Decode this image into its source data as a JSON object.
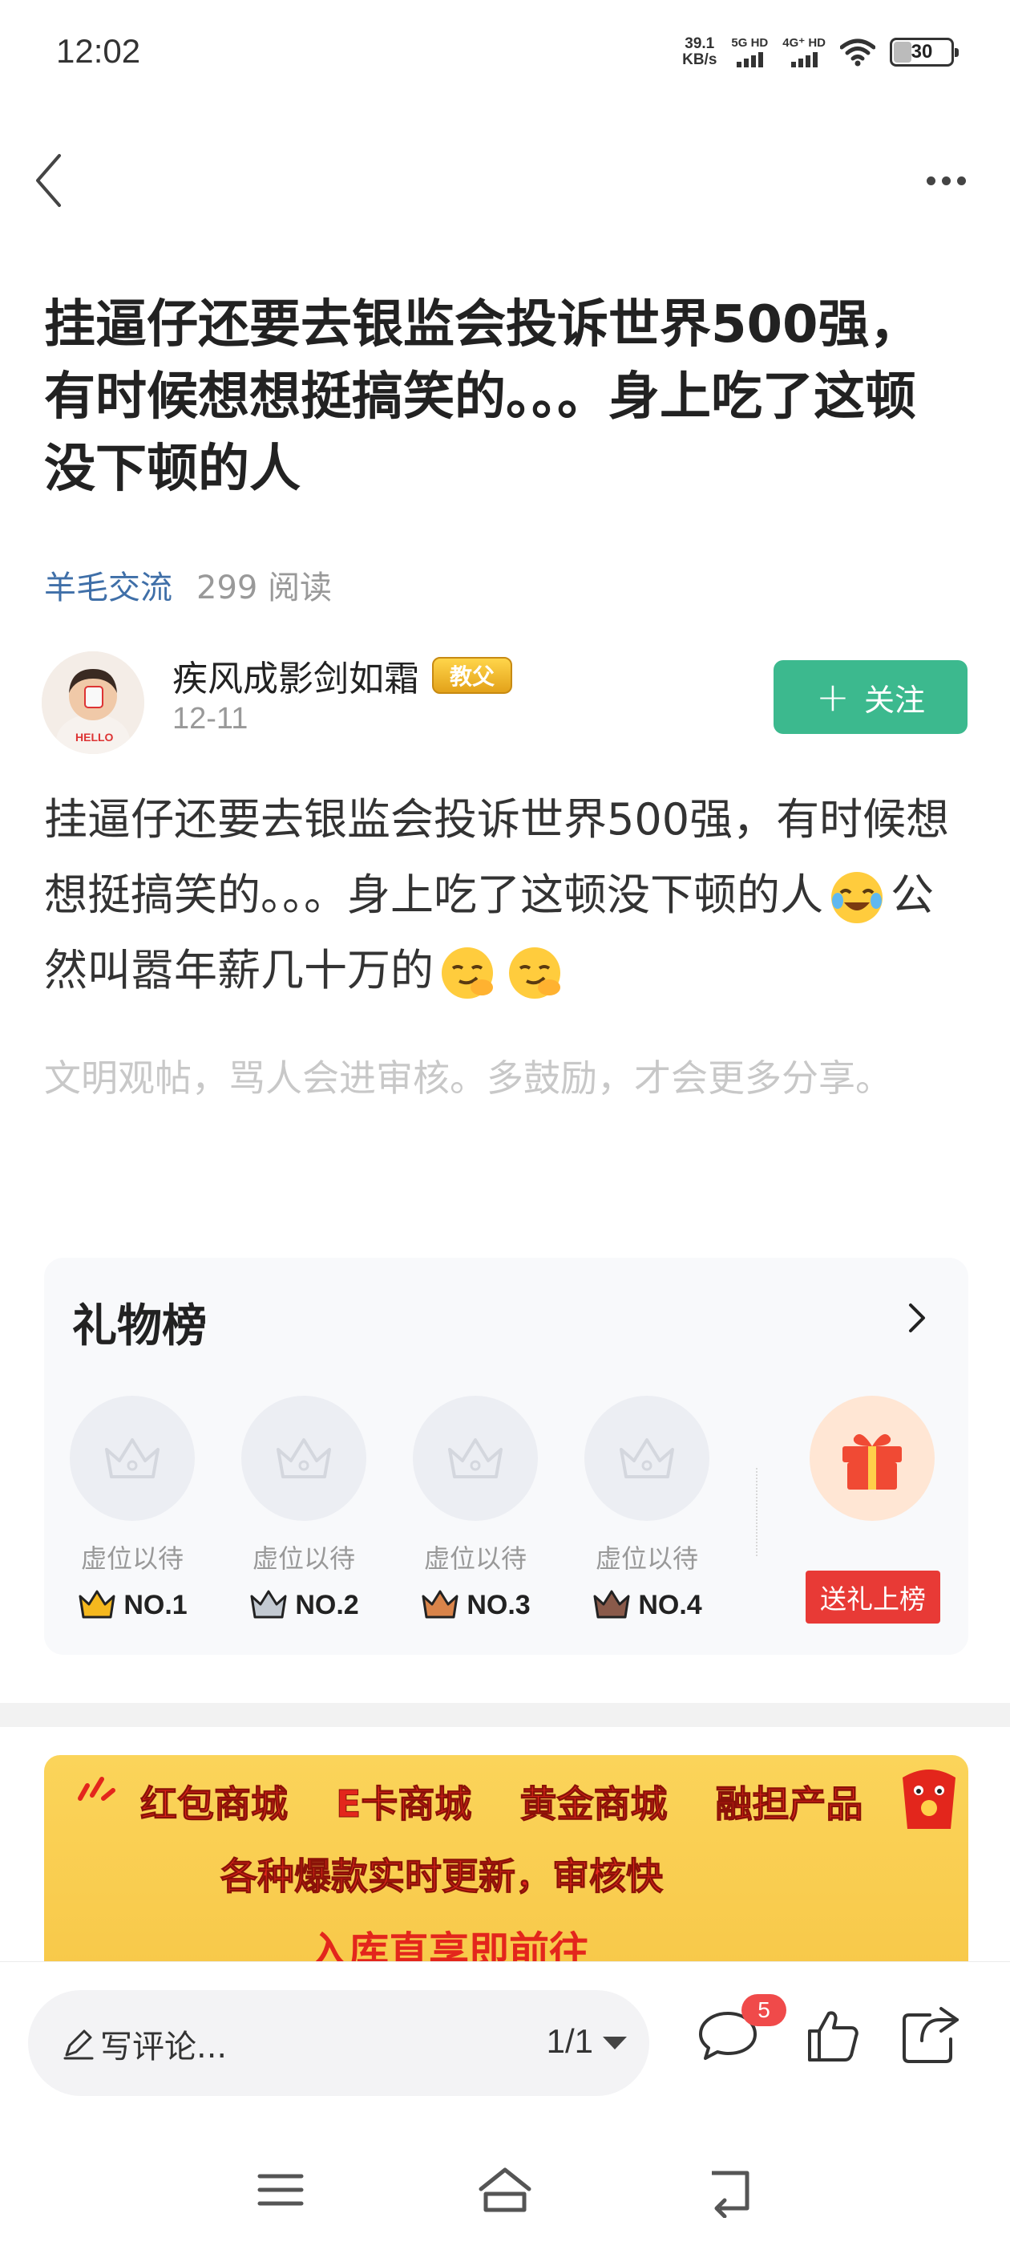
{
  "status_bar": {
    "time": "12:02",
    "net_speed_value": "39.1",
    "net_speed_unit": "KB/s",
    "signal1_label": "5G HD",
    "signal2_label": "4G⁺ HD",
    "battery_level": "30",
    "battery_fraction": 0.3
  },
  "nav": {
    "back_icon": "chevron-left-icon",
    "more_icon": "more-dots-icon"
  },
  "post": {
    "title": "挂逼仔还要去银监会投诉世界500强，有时候想想挺搞笑的。。。身上吃了这顿没下顿的人",
    "category": "羊毛交流",
    "reads": "299 阅读",
    "author": {
      "name": "疾风成影剑如霜",
      "badge": "教父",
      "date": "12-11"
    },
    "follow_label": "关注",
    "body_text_1": "挂逼仔还要去银监会投诉世界500强，有时候想想挺搞笑的。。。身上吃了这顿没下顿的人",
    "body_text_2": "公然叫嚣年薪几十万的",
    "hint": "文明观帖，骂人会进审核。多鼓励，才会更多分享。"
  },
  "gift_board": {
    "title": "礼物榜",
    "slots": [
      {
        "label": "虚位以待",
        "rank": "NO.1",
        "crown_color": "#f5b81e"
      },
      {
        "label": "虚位以待",
        "rank": "NO.2",
        "crown_color": "#9aa3ad"
      },
      {
        "label": "虚位以待",
        "rank": "NO.3",
        "crown_color": "#c9743a"
      },
      {
        "label": "虚位以待",
        "rank": "NO.4",
        "crown_color": "#8a5a4a"
      }
    ],
    "send_label": "送礼上榜"
  },
  "ad": {
    "items": [
      "红包商城",
      "E卡商城",
      "黄金商城",
      "融担产品"
    ],
    "line2": "各种爆款实时更新，审核快",
    "line3": "入库直享即前往"
  },
  "bottom_bar": {
    "comment_placeholder": "写评论...",
    "page_indicator": "1/1",
    "comment_count": "5"
  },
  "colors": {
    "accent_green": "#3cb98e",
    "category_blue": "#3f6fa8",
    "gift_red": "#e83a36",
    "badge_red": "#f04a4a"
  }
}
